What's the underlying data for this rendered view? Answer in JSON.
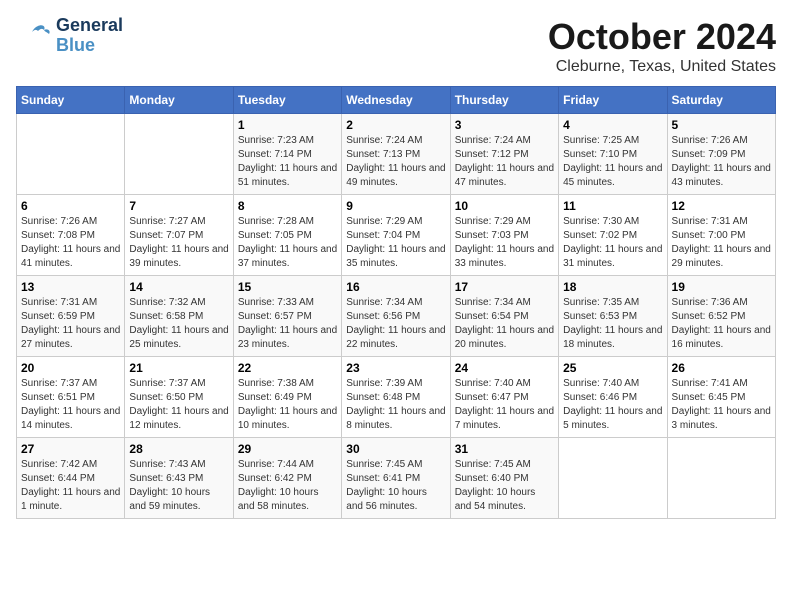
{
  "header": {
    "logo_general": "General",
    "logo_blue": "Blue",
    "main_title": "October 2024",
    "subtitle": "Cleburne, Texas, United States"
  },
  "calendar": {
    "columns": [
      "Sunday",
      "Monday",
      "Tuesday",
      "Wednesday",
      "Thursday",
      "Friday",
      "Saturday"
    ],
    "weeks": [
      [
        {
          "day": "",
          "info": ""
        },
        {
          "day": "",
          "info": ""
        },
        {
          "day": "1",
          "info": "Sunrise: 7:23 AM\nSunset: 7:14 PM\nDaylight: 11 hours and 51 minutes."
        },
        {
          "day": "2",
          "info": "Sunrise: 7:24 AM\nSunset: 7:13 PM\nDaylight: 11 hours and 49 minutes."
        },
        {
          "day": "3",
          "info": "Sunrise: 7:24 AM\nSunset: 7:12 PM\nDaylight: 11 hours and 47 minutes."
        },
        {
          "day": "4",
          "info": "Sunrise: 7:25 AM\nSunset: 7:10 PM\nDaylight: 11 hours and 45 minutes."
        },
        {
          "day": "5",
          "info": "Sunrise: 7:26 AM\nSunset: 7:09 PM\nDaylight: 11 hours and 43 minutes."
        }
      ],
      [
        {
          "day": "6",
          "info": "Sunrise: 7:26 AM\nSunset: 7:08 PM\nDaylight: 11 hours and 41 minutes."
        },
        {
          "day": "7",
          "info": "Sunrise: 7:27 AM\nSunset: 7:07 PM\nDaylight: 11 hours and 39 minutes."
        },
        {
          "day": "8",
          "info": "Sunrise: 7:28 AM\nSunset: 7:05 PM\nDaylight: 11 hours and 37 minutes."
        },
        {
          "day": "9",
          "info": "Sunrise: 7:29 AM\nSunset: 7:04 PM\nDaylight: 11 hours and 35 minutes."
        },
        {
          "day": "10",
          "info": "Sunrise: 7:29 AM\nSunset: 7:03 PM\nDaylight: 11 hours and 33 minutes."
        },
        {
          "day": "11",
          "info": "Sunrise: 7:30 AM\nSunset: 7:02 PM\nDaylight: 11 hours and 31 minutes."
        },
        {
          "day": "12",
          "info": "Sunrise: 7:31 AM\nSunset: 7:00 PM\nDaylight: 11 hours and 29 minutes."
        }
      ],
      [
        {
          "day": "13",
          "info": "Sunrise: 7:31 AM\nSunset: 6:59 PM\nDaylight: 11 hours and 27 minutes."
        },
        {
          "day": "14",
          "info": "Sunrise: 7:32 AM\nSunset: 6:58 PM\nDaylight: 11 hours and 25 minutes."
        },
        {
          "day": "15",
          "info": "Sunrise: 7:33 AM\nSunset: 6:57 PM\nDaylight: 11 hours and 23 minutes."
        },
        {
          "day": "16",
          "info": "Sunrise: 7:34 AM\nSunset: 6:56 PM\nDaylight: 11 hours and 22 minutes."
        },
        {
          "day": "17",
          "info": "Sunrise: 7:34 AM\nSunset: 6:54 PM\nDaylight: 11 hours and 20 minutes."
        },
        {
          "day": "18",
          "info": "Sunrise: 7:35 AM\nSunset: 6:53 PM\nDaylight: 11 hours and 18 minutes."
        },
        {
          "day": "19",
          "info": "Sunrise: 7:36 AM\nSunset: 6:52 PM\nDaylight: 11 hours and 16 minutes."
        }
      ],
      [
        {
          "day": "20",
          "info": "Sunrise: 7:37 AM\nSunset: 6:51 PM\nDaylight: 11 hours and 14 minutes."
        },
        {
          "day": "21",
          "info": "Sunrise: 7:37 AM\nSunset: 6:50 PM\nDaylight: 11 hours and 12 minutes."
        },
        {
          "day": "22",
          "info": "Sunrise: 7:38 AM\nSunset: 6:49 PM\nDaylight: 11 hours and 10 minutes."
        },
        {
          "day": "23",
          "info": "Sunrise: 7:39 AM\nSunset: 6:48 PM\nDaylight: 11 hours and 8 minutes."
        },
        {
          "day": "24",
          "info": "Sunrise: 7:40 AM\nSunset: 6:47 PM\nDaylight: 11 hours and 7 minutes."
        },
        {
          "day": "25",
          "info": "Sunrise: 7:40 AM\nSunset: 6:46 PM\nDaylight: 11 hours and 5 minutes."
        },
        {
          "day": "26",
          "info": "Sunrise: 7:41 AM\nSunset: 6:45 PM\nDaylight: 11 hours and 3 minutes."
        }
      ],
      [
        {
          "day": "27",
          "info": "Sunrise: 7:42 AM\nSunset: 6:44 PM\nDaylight: 11 hours and 1 minute."
        },
        {
          "day": "28",
          "info": "Sunrise: 7:43 AM\nSunset: 6:43 PM\nDaylight: 10 hours and 59 minutes."
        },
        {
          "day": "29",
          "info": "Sunrise: 7:44 AM\nSunset: 6:42 PM\nDaylight: 10 hours and 58 minutes."
        },
        {
          "day": "30",
          "info": "Sunrise: 7:45 AM\nSunset: 6:41 PM\nDaylight: 10 hours and 56 minutes."
        },
        {
          "day": "31",
          "info": "Sunrise: 7:45 AM\nSunset: 6:40 PM\nDaylight: 10 hours and 54 minutes."
        },
        {
          "day": "",
          "info": ""
        },
        {
          "day": "",
          "info": ""
        }
      ]
    ]
  }
}
